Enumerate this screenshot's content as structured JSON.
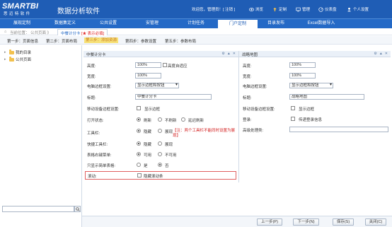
{
  "brand": {
    "logo_text": "SMARTBI",
    "logo_sub": "思迈特软件",
    "app_title": "数据分析软件"
  },
  "header": {
    "welcome": "欢迎您，管理员！[ 注销 ]",
    "actions": [
      {
        "label": "浏览",
        "icon": "eye-icon"
      },
      {
        "label": "定制",
        "icon": "pin-icon"
      },
      {
        "label": "管理",
        "icon": "monitor-icon"
      },
      {
        "label": "仪表盘",
        "icon": "gauge-icon"
      },
      {
        "label": "个人设置",
        "icon": "user-icon"
      }
    ]
  },
  "nav": {
    "items": [
      "展现定制",
      "数据集定义",
      "公共设置",
      "安管理",
      "计划任务",
      "门户定制",
      "目录发布",
      "Excel数据导入"
    ],
    "active_index": 5
  },
  "breadcrumb": {
    "location": "当前位置：  公共页面 》",
    "tab_label": "中餐计分卡",
    "tab_suffix": "[★ 表示必填]"
  },
  "steps": {
    "items": [
      "第一步：页面信息",
      "第二步：页面布局",
      "第三步：添加资源",
      "第四步：参数设置",
      "第五步：参数布局"
    ],
    "current_index": 2
  },
  "tree": {
    "items": [
      "我的目录",
      "公共页面"
    ]
  },
  "left_panel": {
    "title": "中餐计分卡",
    "height_label": "高度:",
    "height_value": "100%",
    "auto_fit_label": "高度自适应",
    "width_label": "宽度:",
    "width_value": "100%",
    "border_label": "电脑边框设置:",
    "border_value": "显示边框和按钮",
    "title_label": "标题:",
    "title_value": "中餐计分卡",
    "mobile_border_label": "移动设备边框设置:",
    "mobile_border_option": "显示边框",
    "open_state_label": "打开状态:",
    "open_state_options": [
      "刷新",
      "不刷新",
      "延迟刷新"
    ],
    "toolbar_label": "工具栏:",
    "toolbar_options": [
      "隐藏",
      "展现"
    ],
    "toolbar_note": "【注：两个工具栏不能同时设置为展现】",
    "quick_toolbar_label": "快捷工具栏:",
    "quick_toolbar_options": [
      "隐藏",
      "展现"
    ],
    "table_menu_label": "表格右键菜单:",
    "table_menu_options": [
      "可用",
      "不可用"
    ],
    "simple_table_label": "只显示简单表格:",
    "simple_table_options": [
      "是",
      "否"
    ],
    "scroll_label": "滚动:",
    "scroll_option": "隐藏滚动条"
  },
  "right_panel": {
    "title": "战略地图",
    "height_label": "高度:",
    "height_value": "100%",
    "width_label": "宽度:",
    "width_value": "100%",
    "border_label": "电脑边框设置:",
    "border_value": "显示边框和按钮",
    "title_label": "标题:",
    "title_value": "战略地图",
    "mobile_border_label": "移动设备边框设置:",
    "mobile_border_option": "显示边框",
    "login_label": "登录:",
    "login_option": "传递登录信息",
    "advanced_label": "高级处理类:",
    "advanced_value": ""
  },
  "footer": {
    "buttons": [
      "上一步(P)",
      "下一步(N)",
      "保存(S)",
      "关闭(C)"
    ]
  },
  "colors": {
    "brand_blue": "#1f5db5",
    "nav_blue": "#2469c6",
    "step_highlight": "#f7e27a",
    "note_red": "#d32020"
  }
}
